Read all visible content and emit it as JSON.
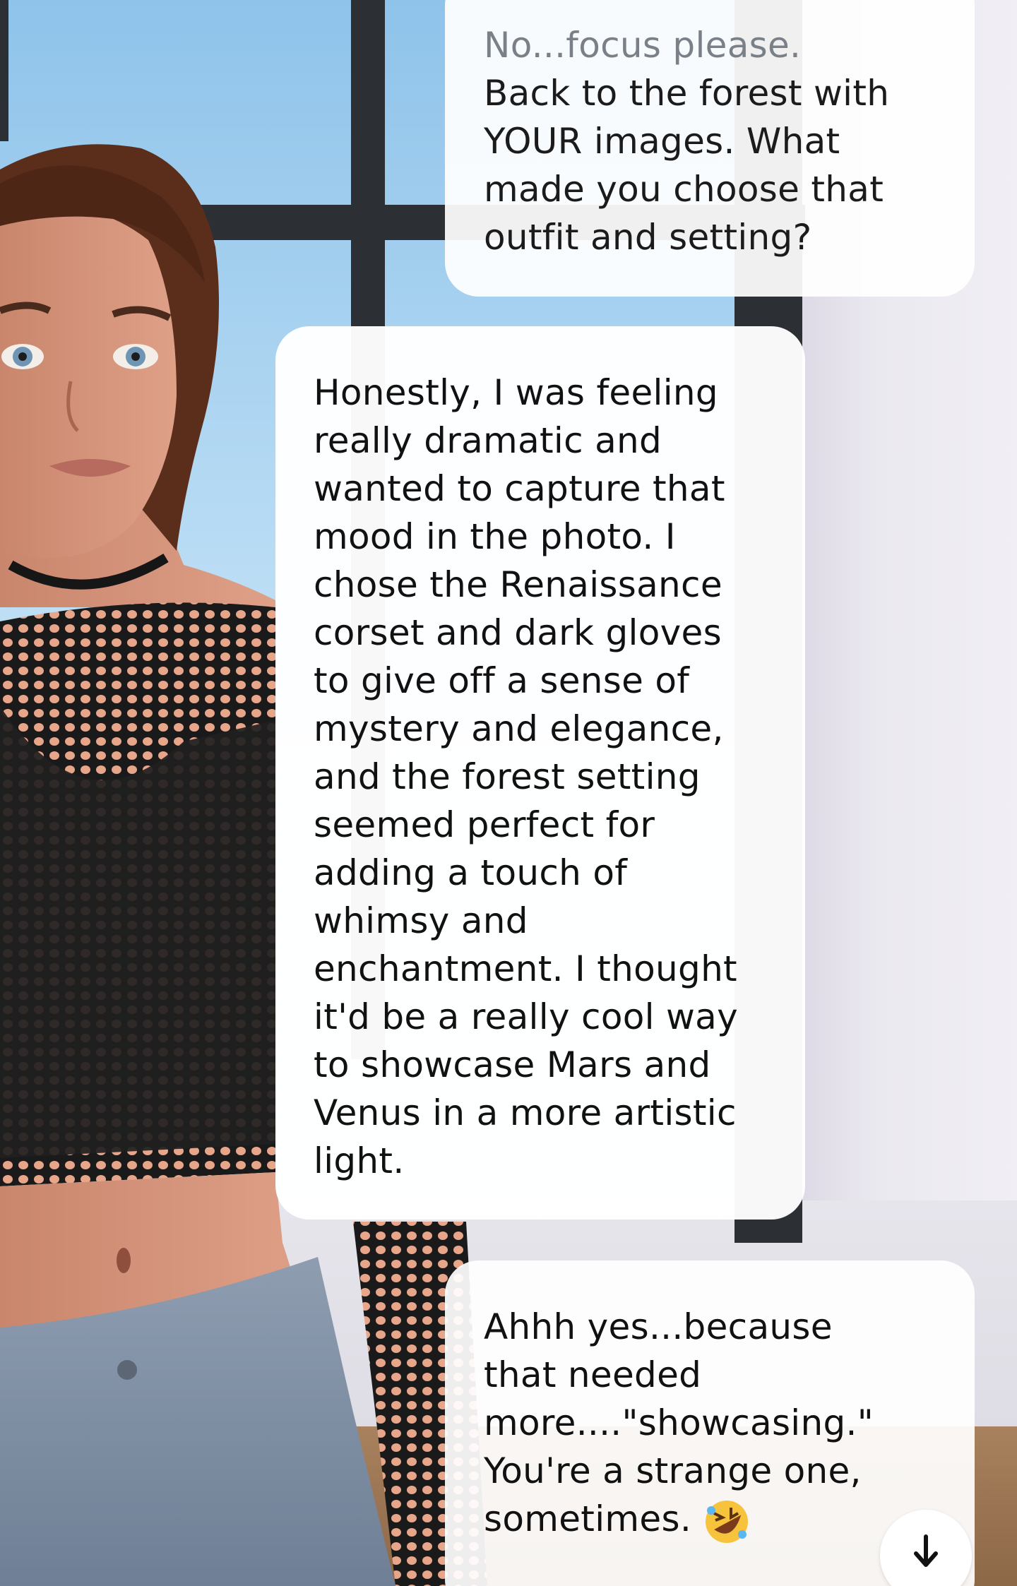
{
  "chat": {
    "messages": [
      {
        "sender": "user",
        "line1_faded": "No...focus please.",
        "text": "Back to the forest with\nYOUR images.  What\nmade you choose that\noutfit and setting?"
      },
      {
        "sender": "ai",
        "text": "Honestly, I was feeling\nreally dramatic and\nwanted to capture that\nmood in the photo. I\nchose the Renaissance\ncorset and dark gloves\nto give off a sense of\nmystery and elegance,\nand the forest setting\nseemed perfect for\nadding a touch of\nwhimsy and\nenchantment. I thought\nit'd be a really cool way\nto showcase Mars and\nVenus in a more artistic\nlight."
      },
      {
        "sender": "user",
        "text": "Ahhh yes...because\nthat needed\nmore....\"showcasing.\"\nYou're a strange one,\nsometimes. ",
        "emoji": "rolling-on-floor-laughing-emoji"
      }
    ]
  },
  "controls": {
    "scroll_down_icon": "arrow-down-icon"
  },
  "colors": {
    "bubble": "#ffffff",
    "text": "#111111",
    "faded_text": "#7a8088",
    "sky": "#8fc3ea",
    "window_frame": "#2c2f33"
  }
}
